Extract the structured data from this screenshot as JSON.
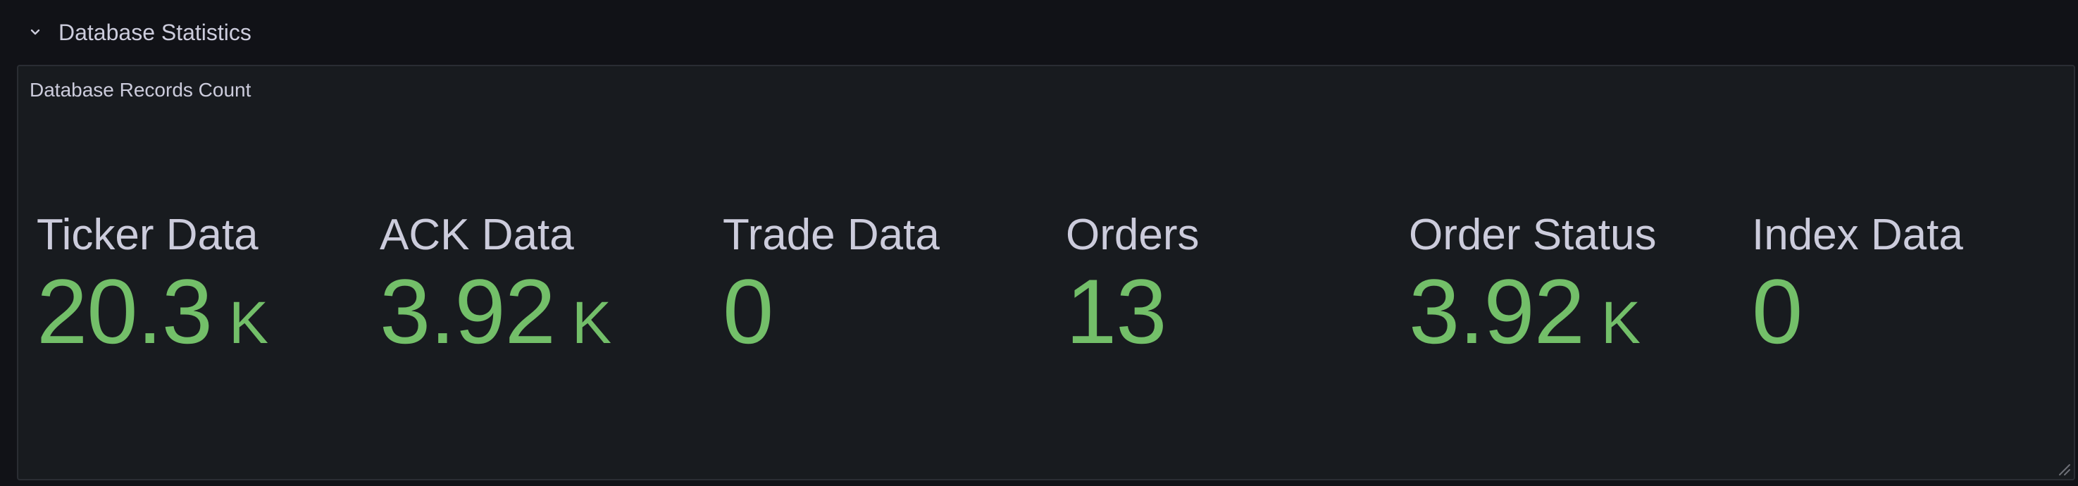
{
  "row": {
    "title": "Database Statistics",
    "collapse_icon": "chevron-down-icon"
  },
  "panel": {
    "title": "Database Records Count",
    "value_color": "#73bf69",
    "stats": [
      {
        "label": "Ticker Data",
        "number": "20.3",
        "unit": "K"
      },
      {
        "label": "ACK Data",
        "number": "3.92",
        "unit": "K"
      },
      {
        "label": "Trade Data",
        "number": "0",
        "unit": ""
      },
      {
        "label": "Orders",
        "number": "13",
        "unit": ""
      },
      {
        "label": "Order Status",
        "number": "3.92",
        "unit": "K"
      },
      {
        "label": "Index Data",
        "number": "0",
        "unit": ""
      }
    ]
  }
}
